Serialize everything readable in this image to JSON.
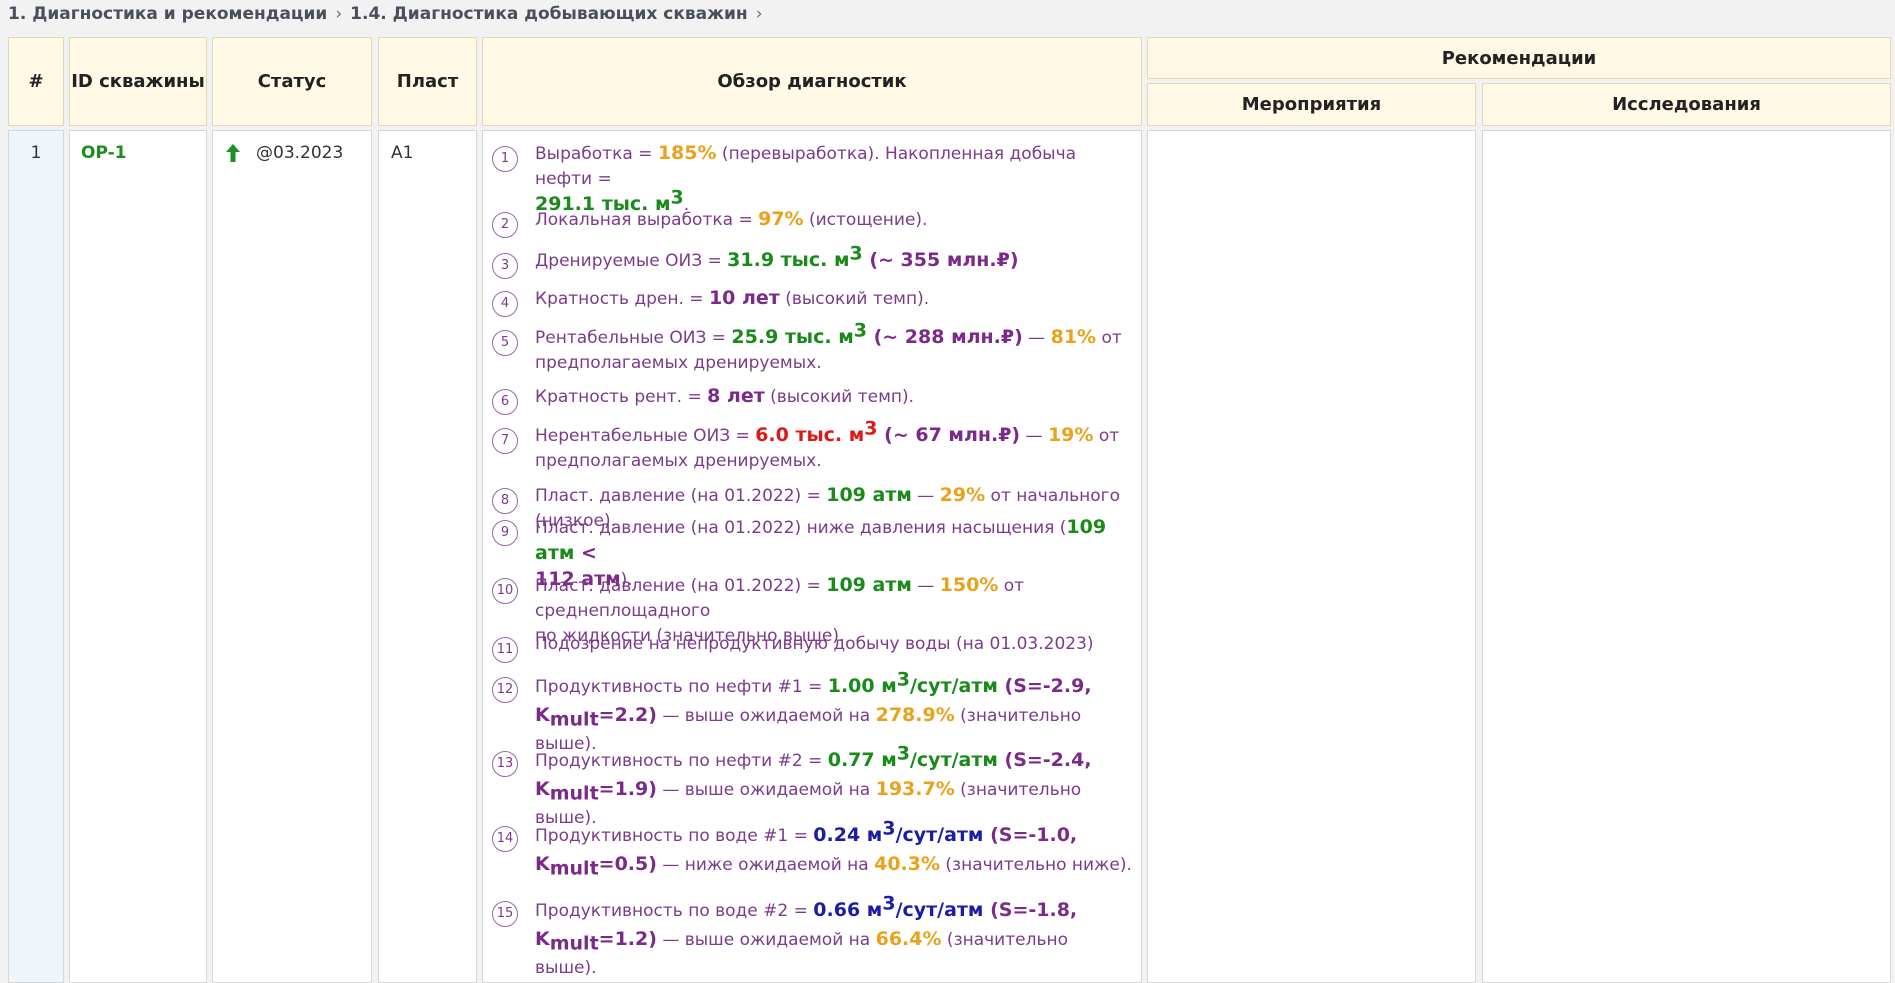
{
  "breadcrumb": {
    "level1": "1. Диагностика и рекомендации",
    "level2": "1.4. Диагностика добывающих скважин",
    "separator": "›"
  },
  "table": {
    "headers": {
      "num": "#",
      "well_id": "ID скважины",
      "status": "Статус",
      "layer": "Пласт",
      "overview": "Обзор диагностик",
      "recommendations": "Рекомендации",
      "measures": "Мероприятия",
      "studies": "Исследования"
    },
    "row": {
      "num": "1",
      "well_id": "OP-1",
      "status_date": "@03.2023",
      "status_icon": "up-arrow-icon",
      "layer": "A1"
    }
  },
  "colors": {
    "green": "#1a8a1a",
    "orange": "#e8a21c",
    "purple": "#7b2a8a",
    "red": "#e01818",
    "blue": "#1c1ca8",
    "header_bg": "#fff9e6"
  },
  "diagnostics": [
    {
      "n": "1",
      "t1": "Выработка = ",
      "v1": "185%",
      "t2": " (перевыработка). Накопленная добыча нефти =",
      "v2": "291.1 тыс. м",
      "sup": "3",
      "t3": "."
    },
    {
      "n": "2",
      "t1": "Локальная выработка = ",
      "v1": "97%",
      "t2": " (истощение)."
    },
    {
      "n": "3",
      "t1": "Дренируемые ОИЗ = ",
      "v1": "31.9 тыс. м",
      "sup": "3",
      "v2": " (~ 355 млн.₽)"
    },
    {
      "n": "4",
      "t1": "Кратность дрен. = ",
      "v1": "10 лет",
      "t2": " (высокий темп)."
    },
    {
      "n": "5",
      "t1": "Рентабельные ОИЗ = ",
      "v1": "25.9 тыс. м",
      "sup": "3",
      "v2": " (~ 288 млн.₽)",
      "t2": " — ",
      "v3": "81%",
      "t3": " от",
      "t4": "предполагаемых дренируемых."
    },
    {
      "n": "6",
      "t1": "Кратность рент. = ",
      "v1": "8 лет",
      "t2": " (высокий темп)."
    },
    {
      "n": "7",
      "t1": "Нерентабельные ОИЗ = ",
      "v1": "6.0 тыс. м",
      "sup": "3",
      "v2": " (~ 67 млн.₽)",
      "t2": " — ",
      "v3": "19%",
      "t3": " от",
      "t4": "предполагаемых дренируемых."
    },
    {
      "n": "8",
      "t1": "Пласт. давление (на 01.2022) = ",
      "v1": "109 атм",
      "t2": " — ",
      "v2": "29%",
      "t3": " от начального (низкое)."
    },
    {
      "n": "9",
      "t1": "Пласт. давление (на 01.2022) ниже давления насыщения (",
      "v1": "109 атм",
      "v2": " <",
      "v3": "112 атм",
      "t2": ")."
    },
    {
      "n": "10",
      "t1": "Пласт. давление (на 01.2022) = ",
      "v1": "109 атм",
      "t2": " — ",
      "v2": "150%",
      "t3": " от среднеплощадного",
      "t4": "по жидкости (значительно выше)."
    },
    {
      "n": "11",
      "t1": "Подозрение на непродуктивную добычу воды (на 01.03.2023)"
    },
    {
      "n": "12",
      "t1": "Продуктивность по нефти #1 = ",
      "v1": "1.00 м",
      "sup": "3",
      "v1b": "/сут/атм",
      "v2": " (S=-2.9,",
      "k": "K",
      "ksub": "mult",
      "v3": "=2.2)",
      "t2": " — выше ожидаемой на ",
      "v4": "278.9%",
      "t3": " (значительно выше)."
    },
    {
      "n": "13",
      "t1": "Продуктивность по нефти #2 = ",
      "v1": "0.77 м",
      "sup": "3",
      "v1b": "/сут/атм",
      "v2": " (S=-2.4,",
      "k": "K",
      "ksub": "mult",
      "v3": "=1.9)",
      "t2": " — выше ожидаемой на ",
      "v4": "193.7%",
      "t3": " (значительно выше)."
    },
    {
      "n": "14",
      "t1": "Продуктивность по воде #1 = ",
      "v1": "0.24 м",
      "sup": "3",
      "v1b": "/сут/атм",
      "v2": " (S=-1.0,",
      "k": "K",
      "ksub": "mult",
      "v3": "=0.5)",
      "t2": " — ниже ожидаемой на ",
      "v4": "40.3%",
      "t3": " (значительно ниже)."
    },
    {
      "n": "15",
      "t1": "Продуктивность по воде #2 = ",
      "v1": "0.66 м",
      "sup": "3",
      "v1b": "/сут/атм",
      "v2": " (S=-1.8,",
      "k": "K",
      "ksub": "mult",
      "v3": "=1.2)",
      "t2": " — выше ожидаемой на ",
      "v4": "66.4%",
      "t3": " (значительно выше)."
    }
  ]
}
